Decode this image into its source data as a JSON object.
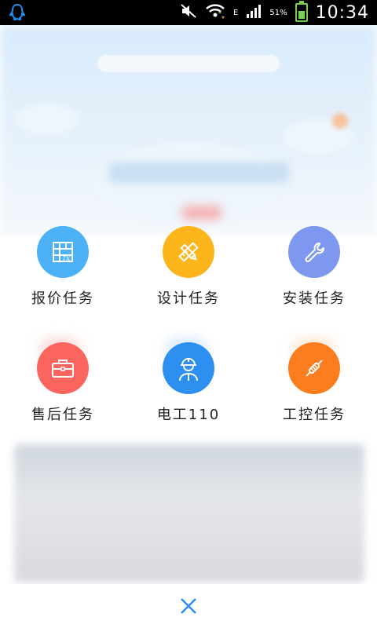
{
  "status_bar": {
    "time": "10:34",
    "network": "E",
    "signal_percent": "51%",
    "app_icon": "qq-penguin-icon"
  },
  "menu": {
    "items": [
      {
        "label": "报价任务",
        "icon": "spreadsheet-fx-icon",
        "color": "#4db1f8"
      },
      {
        "label": "设计任务",
        "icon": "ruler-pencil-icon",
        "color": "#fdb51c"
      },
      {
        "label": "安装任务",
        "icon": "wrench-icon",
        "color": "#7d98ee"
      },
      {
        "label": "售后任务",
        "icon": "briefcase-icon",
        "color": "#fa665e"
      },
      {
        "label": "电工110",
        "icon": "worker-helmet-icon",
        "color": "#2d8ff0"
      },
      {
        "label": "工控任务",
        "icon": "tester-pen-icon",
        "color": "#fb7d1d"
      }
    ]
  },
  "bottom": {
    "close_icon": "close-icon",
    "accent": "#2d8ff0"
  }
}
